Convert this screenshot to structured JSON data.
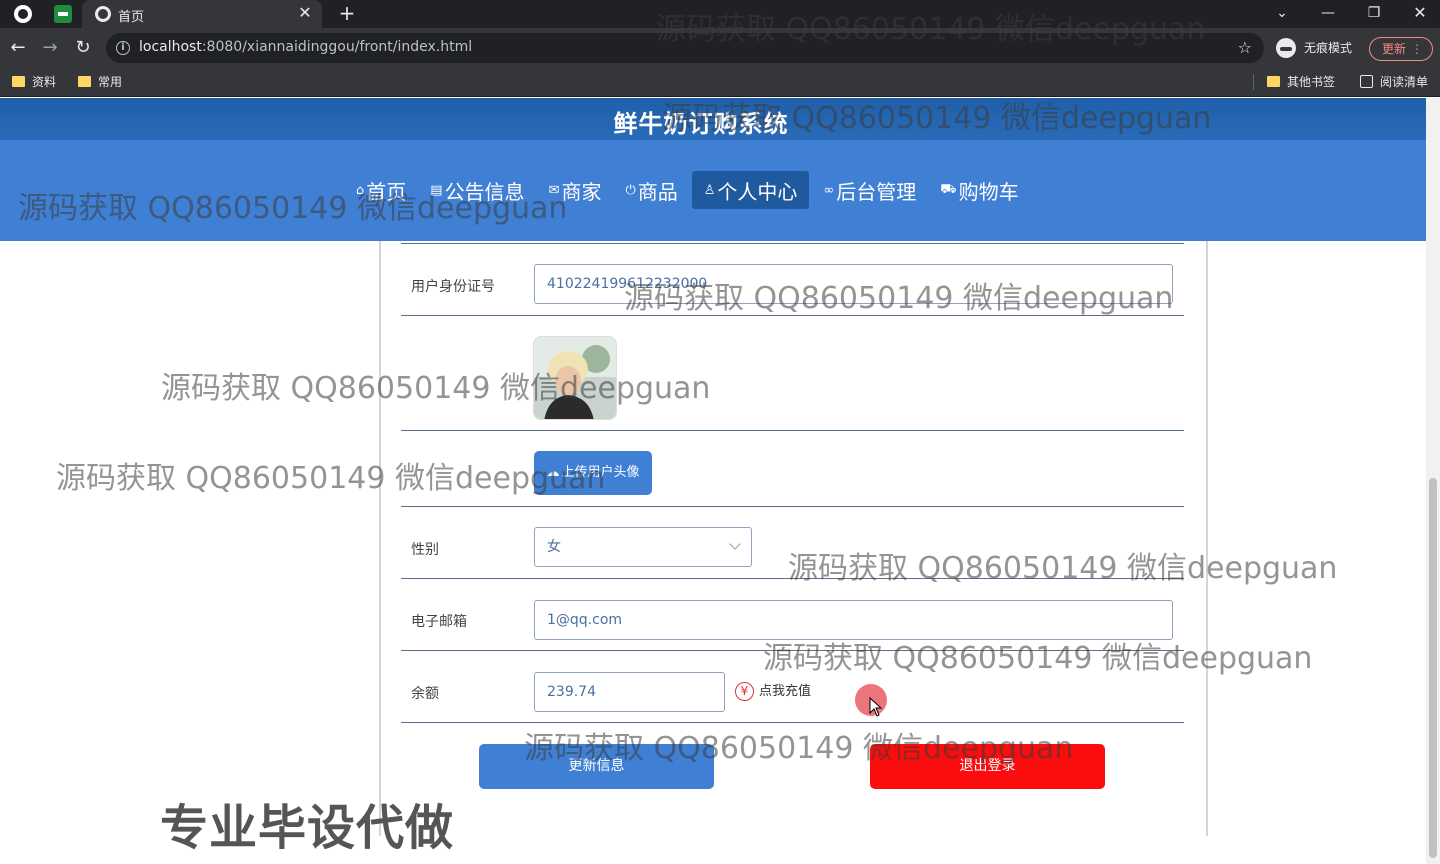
{
  "browser": {
    "tab_title": "首页",
    "url_host": "localhost",
    "url_path": ":8080/xiannaidinggou/front/index.html",
    "incognito_label": "无痕模式",
    "update_label": "更新",
    "bookmarks": [
      "资料",
      "常用"
    ],
    "other_bookmarks": "其他书签",
    "reading_list": "阅读清单"
  },
  "site": {
    "title": "鲜牛奶订购系统",
    "nav": [
      {
        "label": "首页",
        "icon": "home-icon"
      },
      {
        "label": "公告信息",
        "icon": "notice-icon"
      },
      {
        "label": "商家",
        "icon": "mail-icon"
      },
      {
        "label": "商品",
        "icon": "power-icon"
      },
      {
        "label": "个人中心",
        "icon": "user-icon",
        "active": true
      },
      {
        "label": "后台管理",
        "icon": "link-icon"
      },
      {
        "label": "购物车",
        "icon": "cart-icon"
      }
    ]
  },
  "form": {
    "id_label": "用户身份证号",
    "id_value": "410224199612232000",
    "upload_label": "上传用户头像",
    "gender_label": "性别",
    "gender_value": "女",
    "email_label": "电子邮箱",
    "email_value": "1@qq.com",
    "balance_label": "余额",
    "balance_value": "239.74",
    "recharge_label": "点我充值",
    "update_button": "更新信息",
    "logout_button": "退出登录"
  },
  "watermark": {
    "text": "源码获取 QQ86050149 微信deepguan",
    "big_text": "专业毕设代做"
  },
  "colors": {
    "nav_bg": "#3f7fd4",
    "title_band": "#1f5fa9",
    "active_nav": "#1f5a9f",
    "logout_red": "#fb0d0d"
  }
}
